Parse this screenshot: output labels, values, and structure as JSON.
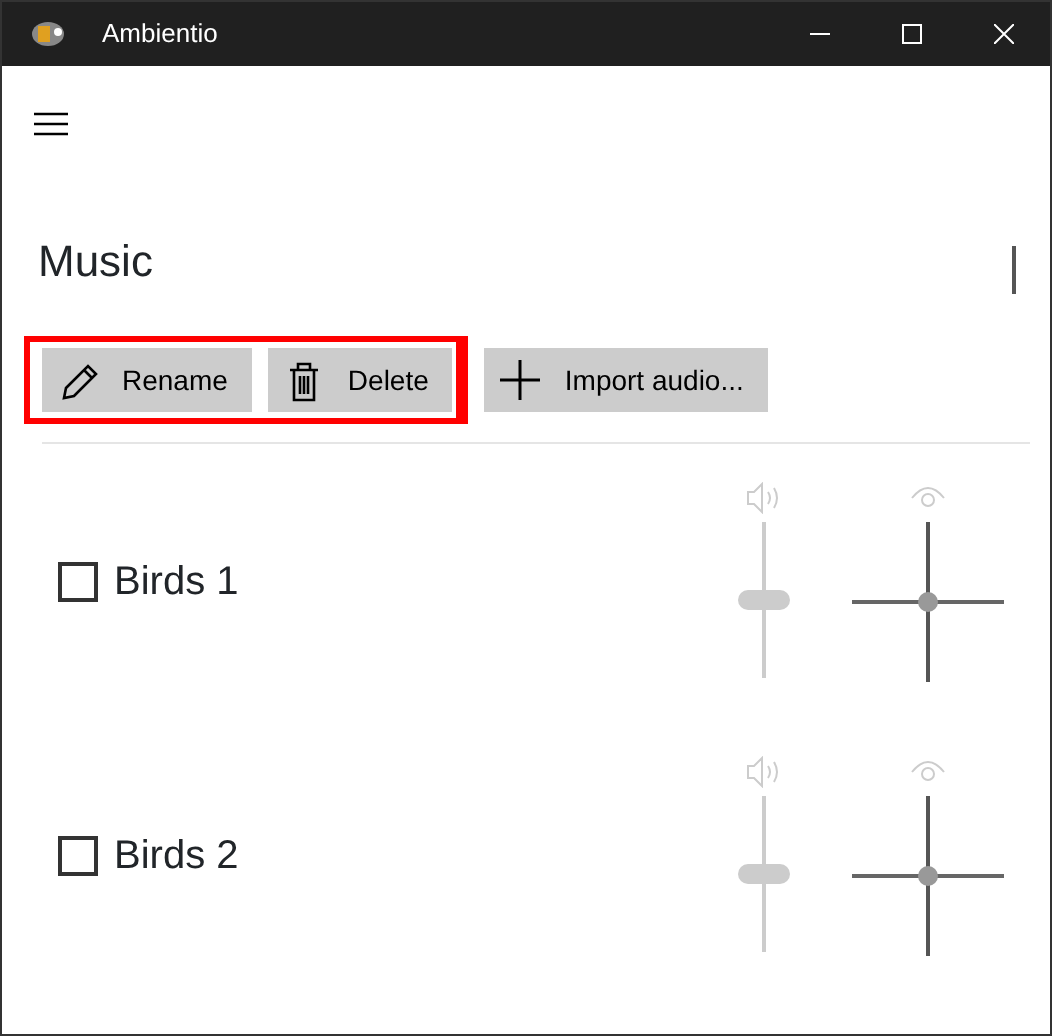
{
  "window": {
    "title": "Ambientio"
  },
  "page": {
    "title": "Music"
  },
  "toolbar": [
    {
      "kind": "pencil",
      "label": "Rename",
      "highlighted": true
    },
    {
      "kind": "trash",
      "label": "Delete",
      "highlighted": true
    },
    {
      "kind": "plus",
      "label": "Import audio...",
      "highlighted": false
    }
  ],
  "sounds": [
    {
      "name": "Birds 1",
      "checked": false,
      "disabled": true,
      "level": 0.5
    },
    {
      "name": "Birds 2",
      "checked": false,
      "disabled": true,
      "level": 0.5
    }
  ]
}
